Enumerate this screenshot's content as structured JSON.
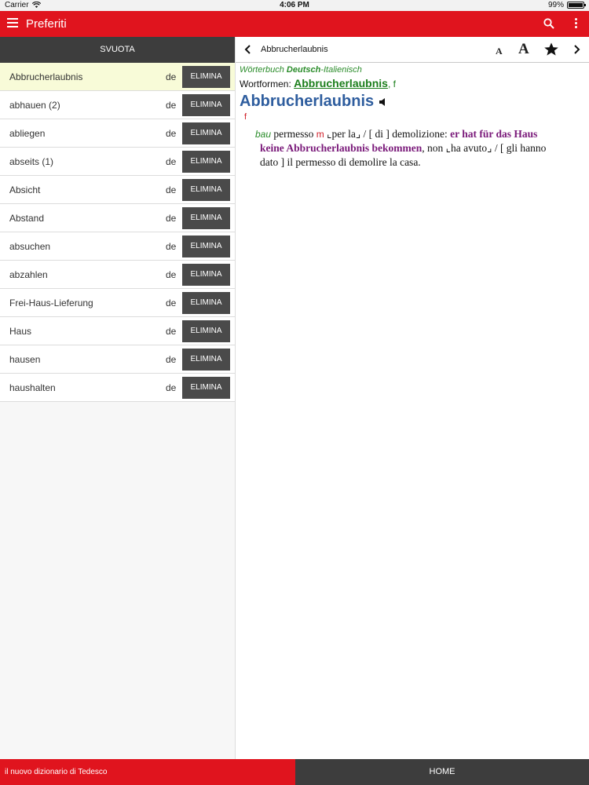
{
  "status": {
    "carrier": "Carrier",
    "time": "4:06 PM",
    "battery": "99%",
    "battery_level": 0.99
  },
  "appbar": {
    "title": "Preferiti",
    "menu_icon": "hamburger-icon",
    "search_icon": "search-icon",
    "more_icon": "kebab-icon"
  },
  "left": {
    "clear_label": "SVUOTA",
    "items": [
      {
        "word": "Abbrucherlaubnis",
        "lang": "de",
        "delete": "ELIMINA",
        "selected": true
      },
      {
        "word": "abhauen (2)",
        "lang": "de",
        "delete": "ELIMINA"
      },
      {
        "word": "abliegen",
        "lang": "de",
        "delete": "ELIMINA"
      },
      {
        "word": "abseits (1)",
        "lang": "de",
        "delete": "ELIMINA"
      },
      {
        "word": "Absicht",
        "lang": "de",
        "delete": "ELIMINA"
      },
      {
        "word": "Abstand",
        "lang": "de",
        "delete": "ELIMINA"
      },
      {
        "word": "absuchen",
        "lang": "de",
        "delete": "ELIMINA"
      },
      {
        "word": "abzahlen",
        "lang": "de",
        "delete": "ELIMINA"
      },
      {
        "word": "Frei-Haus-Lieferung",
        "lang": "de",
        "delete": "ELIMINA"
      },
      {
        "word": "Haus",
        "lang": "de",
        "delete": "ELIMINA"
      },
      {
        "word": "hausen",
        "lang": "de",
        "delete": "ELIMINA"
      },
      {
        "word": "haushalten",
        "lang": "de",
        "delete": "ELIMINA"
      }
    ]
  },
  "right": {
    "toolbar": {
      "heading": "Abbrucherlaubnis",
      "font_small": "A",
      "font_large": "A"
    },
    "entry": {
      "dict_prefix": "Wörterbuch ",
      "dict_lang1": "Deutsch",
      "dict_suffix": "-Italienisch",
      "wordforms_label": "Wortformen",
      "wordforms_colon": ": ",
      "wordforms_link": "Abbrucherlaubnis",
      "wordforms_gender": ", f",
      "headword": "Abbrucherlaubnis",
      "gender": "f",
      "domain": "bau",
      "translation1": " permesso ",
      "gender_m": "m",
      "translation2": " ⌞per la⌟ / [ di ] demolizione: ",
      "example1": "er hat für das Haus",
      "example2": "keine Abbrucherlaubnis bekommen",
      "translation3": ", non ⌞ha avuto⌟ / [ gli hanno",
      "translation4": "dato ] il permesso di demolire la casa."
    }
  },
  "bottom": {
    "left_text": "il nuovo dizionario di Tedesco",
    "home_label": "HOME"
  }
}
